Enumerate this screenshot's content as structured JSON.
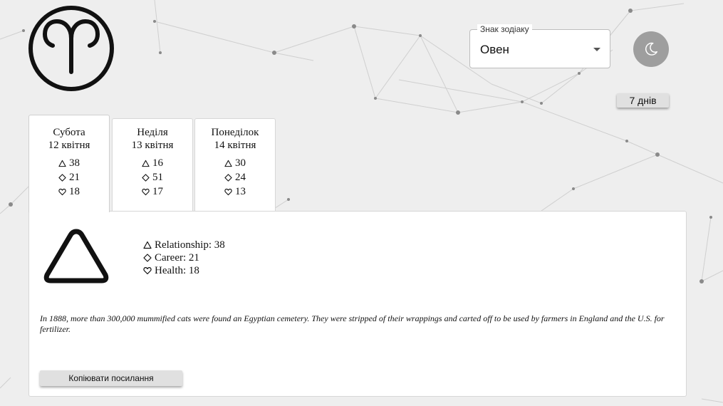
{
  "header": {
    "logo_icon": "aries-zodiac-icon",
    "sign_select": {
      "label": "Знак зодіаку",
      "value": "Овен"
    },
    "theme_toggle_icon": "crescent-moon-icon",
    "range_button_label": "7 днів"
  },
  "score_icons": {
    "relationship": "triangle-icon",
    "career": "diamond-icon",
    "health": "heart-icon"
  },
  "days": [
    {
      "day": "Субота",
      "date": "12 квітня",
      "relationship": "38",
      "career": "21",
      "health": "18",
      "active": true
    },
    {
      "day": "Неділя",
      "date": "13 квітня",
      "relationship": "16",
      "career": "51",
      "health": "17",
      "active": false
    },
    {
      "day": "Понеділок",
      "date": "14 квітня",
      "relationship": "30",
      "career": "24",
      "health": "13",
      "active": false
    }
  ],
  "detail": {
    "big_icon": "triangle-icon",
    "relationship": "Relationship: 38",
    "career": "Career: 21",
    "health": "Health: 18",
    "fact": "In 1888, more than 300,000 mummified cats were found an Egyptian cemetery. They were stripped of their wrappings and carted off to be used by farmers in England and the U.S. for fertilizer.",
    "copy_button_label": "Копіювати посилання"
  },
  "colors": {
    "background": "#eeeeee",
    "toggle": "#9e9e9e",
    "button": "#e0e0e0"
  }
}
